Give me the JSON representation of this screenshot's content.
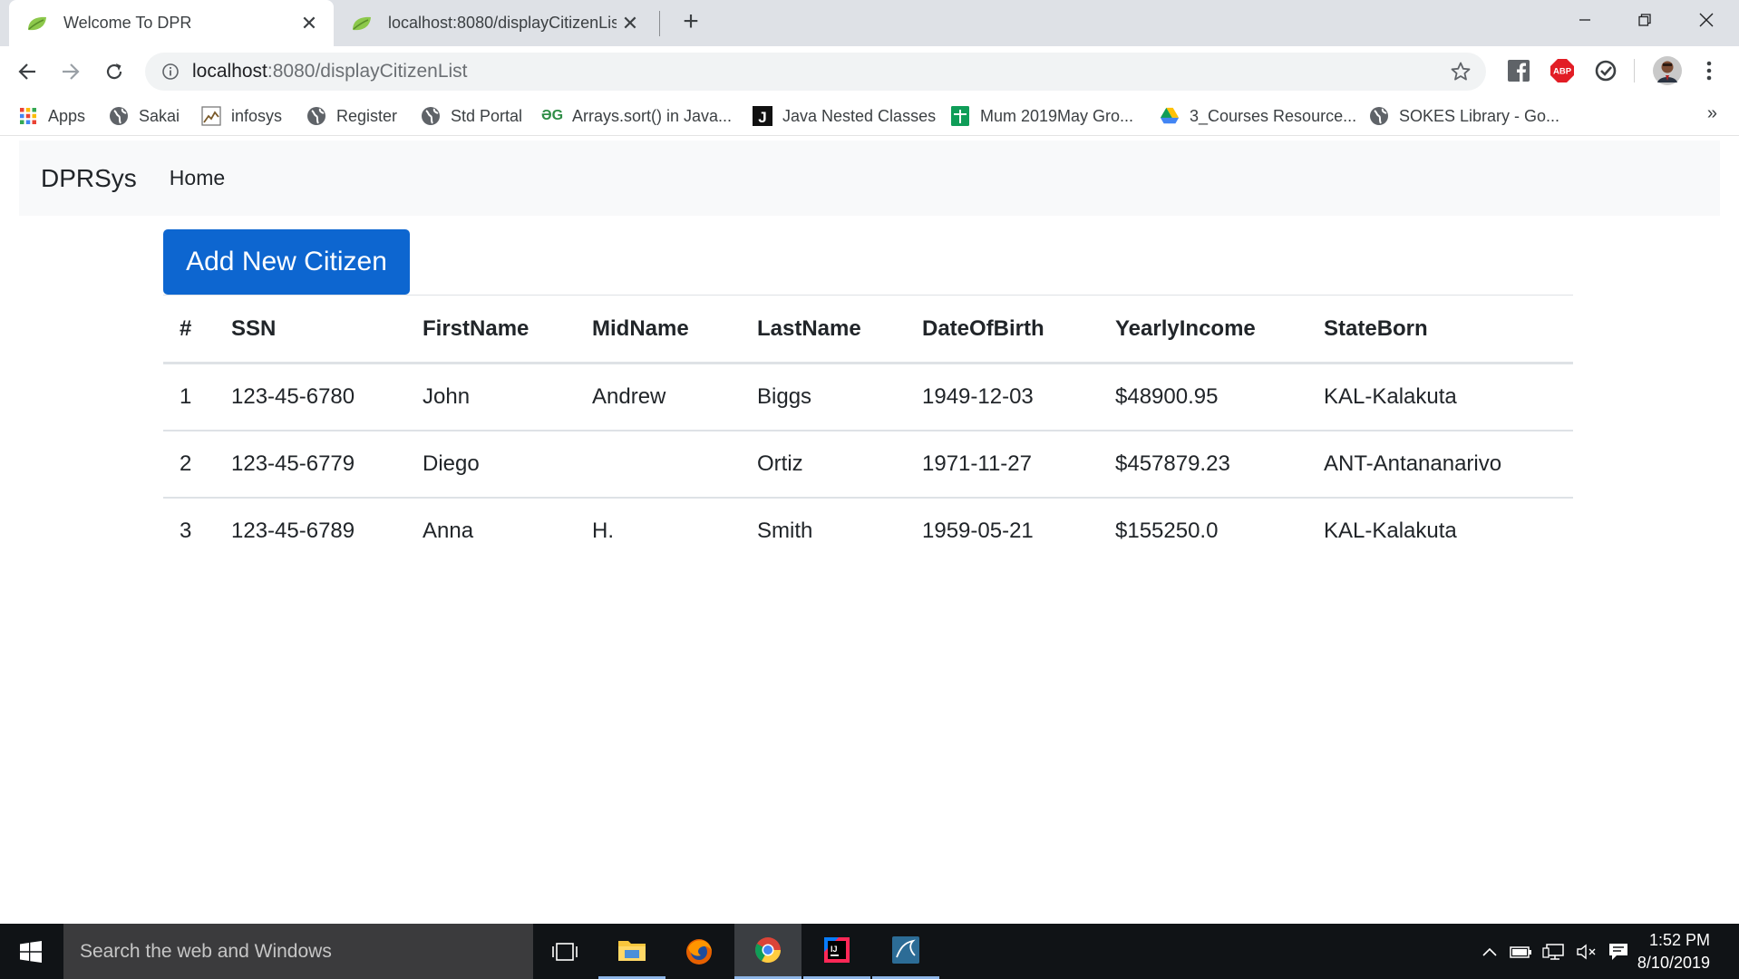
{
  "browser": {
    "tabs": [
      {
        "title": "Welcome To DPR",
        "active": true
      },
      {
        "title": "localhost:8080/displayCitizenList",
        "active": false
      }
    ],
    "address": {
      "host": "localhost",
      "path": ":8080/displayCitizenList"
    },
    "bookmarks": [
      {
        "label": "Apps",
        "icon": "apps-grid-icon"
      },
      {
        "label": "Sakai",
        "icon": "globe-icon"
      },
      {
        "label": "infosys",
        "icon": "infosys-icon"
      },
      {
        "label": "Register",
        "icon": "globe-icon"
      },
      {
        "label": "Std Portal",
        "icon": "globe-icon"
      },
      {
        "label": "Arrays.sort() in Java...",
        "icon": "geeksforgeeks-icon"
      },
      {
        "label": "Java Nested Classes",
        "icon": "j-icon"
      },
      {
        "label": "Mum 2019May Gro...",
        "icon": "sheets-icon"
      },
      {
        "label": "3_Courses Resource...",
        "icon": "drive-icon"
      },
      {
        "label": "SOKES Library - Go...",
        "icon": "globe-icon"
      }
    ],
    "bookmarks_overflow": "»"
  },
  "app": {
    "brand": "DPRSys",
    "nav_home": "Home",
    "add_button": "Add New Citizen",
    "accent_color": "#0d66d0"
  },
  "table": {
    "headers": [
      "#",
      "SSN",
      "FirstName",
      "MidName",
      "LastName",
      "DateOfBirth",
      "YearlyIncome",
      "StateBorn"
    ],
    "rows": [
      [
        "1",
        "123-45-6780",
        "John",
        "Andrew",
        "Biggs",
        "1949-12-03",
        "$48900.95",
        "KAL-Kalakuta"
      ],
      [
        "2",
        "123-45-6779",
        "Diego",
        "",
        "Ortiz",
        "1971-11-27",
        "$457879.23",
        "ANT-Antananarivo"
      ],
      [
        "3",
        "123-45-6789",
        "Anna",
        "H.",
        "Smith",
        "1959-05-21",
        "$155250.0",
        "KAL-Kalakuta"
      ]
    ]
  },
  "taskbar": {
    "search_placeholder": "Search the web and Windows",
    "time": "1:52 PM",
    "date": "8/10/2019"
  }
}
